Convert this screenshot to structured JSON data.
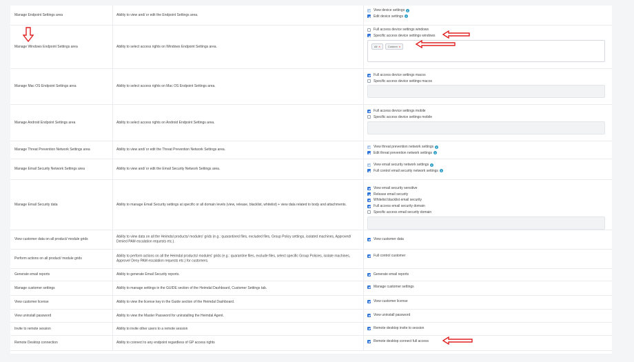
{
  "rows": [
    {
      "name": "Manage Endpoint Settings area",
      "desc": "Ability to view and/ or edit the Endpoint Settings area.",
      "perms": [
        {
          "label": "View device settings",
          "state": "disabled",
          "info": true
        },
        {
          "label": "Edit device settings",
          "state": "checked",
          "info": true
        }
      ]
    },
    {
      "name": "Manage Windows Endpoint Settings area",
      "desc": "Ability to select access rights on Windows Endpoint Settings area.",
      "perms": [
        {
          "label": "Full access device settings windows",
          "state": "unchecked"
        },
        {
          "label": "Specific access device settings windows",
          "state": "checked"
        }
      ],
      "tags": [
        "All",
        "Custom"
      ]
    },
    {
      "name": "Manage Mac OS Endpoint Settings area",
      "desc": "Ability to select access rights on Mac OS Endpoint Settings area.",
      "perms": [
        {
          "label": "Full access device settings macos",
          "state": "checked"
        },
        {
          "label": "Specific access device settings macos",
          "state": "unchecked"
        }
      ]
    },
    {
      "name": "Manage Android Endpoint Settings area",
      "desc": "Ability to select access rights on Android Endpoint Settings area.",
      "perms": [
        {
          "label": "Full access device settings mobile",
          "state": "checked"
        },
        {
          "label": "Specific access device settings mobile",
          "state": "unchecked"
        }
      ]
    },
    {
      "name": "Manage Threat Prevention Network Settings area",
      "desc": "Ability to view and/ or edit the Threat Prevention Network Settings area.",
      "perms": [
        {
          "label": "View threat prevention network settings",
          "state": "disabled",
          "info": true
        },
        {
          "label": "Edit threat prevention network settings",
          "state": "checked",
          "info": true
        }
      ]
    },
    {
      "name": "Manage Email Security Network Settings area",
      "desc": "Ability to view and/ or edit the Email Security Network Settings area.",
      "perms": [
        {
          "label": "View email security network settings",
          "state": "disabled",
          "info": true
        },
        {
          "label": "Full control email security network settings",
          "state": "checked",
          "info": true
        }
      ]
    },
    {
      "name": "Manage Email Security data",
      "desc": "Ability to manage Email Security settings at specific or all domain levels (view, release, blacklist, whitelist) + view data related to body and attachments.",
      "perms": [
        {
          "label": "View email security sensitive",
          "state": "checked"
        },
        {
          "label": "Release email security",
          "state": "checked"
        },
        {
          "label": "Whitelist blacklist email security",
          "state": "checked"
        },
        {
          "label": "Full access email security domain",
          "state": "checked"
        },
        {
          "label": "Specific access email security domain",
          "state": "unchecked"
        }
      ]
    },
    {
      "name": "View customer data on all product/ module grids",
      "desc": "Ability to view data on all the Heimdal products/ modules' grids (e.g.: quarantined files, excluded files, Group Policy settings, isolated machines, Approved/ Denied PAM escalation requests etc.).",
      "perms": [
        {
          "label": "View customer data",
          "state": "checked"
        }
      ]
    },
    {
      "name": "Perform actions on all product/ module grids",
      "desc": "Ability to perform actions on all the Heimdal products/ modules' grids (e.g.: quarantine files, exclude files, select specific Group Policies, isolate machines, Approve/ Deny PAM escalation requests etc.) for customers.",
      "perms": [
        {
          "label": "Full control customer",
          "state": "checked"
        }
      ]
    },
    {
      "name": "Generate email reports",
      "desc": "Ability to generate Email Security reports.",
      "perms": [
        {
          "label": "Generate email reports",
          "state": "checked"
        }
      ]
    },
    {
      "name": "Manage customer settings",
      "desc": "Ability to manage settings in the GUIDE section of the Heimdal Dashboard, Customer Settings tab.",
      "perms": [
        {
          "label": "Manage customer settings",
          "state": "checked"
        }
      ]
    },
    {
      "name": "View customer license",
      "desc": "Ability to view the license key in the Guide section of the Heimdal Dashboard.",
      "perms": [
        {
          "label": "View customer license",
          "state": "checked"
        }
      ]
    },
    {
      "name": "View uninstall password",
      "desc": "Ability to view the Master Password for uninstalling the Heimdal Agent.",
      "perms": [
        {
          "label": "View uninstall password",
          "state": "checked"
        }
      ]
    },
    {
      "name": "Invite to remote session",
      "desc": "Ability to invite other users to a remote session",
      "perms": [
        {
          "label": "Remote desktop invite to session",
          "state": "checked"
        }
      ]
    },
    {
      "name": "Remote Desktop connection",
      "desc": "Ability to connect to any endpoint regardless of GP access rights",
      "perms": [
        {
          "label": "Remote desktop connect full access",
          "state": "checked"
        }
      ]
    }
  ],
  "colors": {
    "accent": "#2e73d8",
    "arrow": "#e02020",
    "info": "#2e9fc7"
  }
}
